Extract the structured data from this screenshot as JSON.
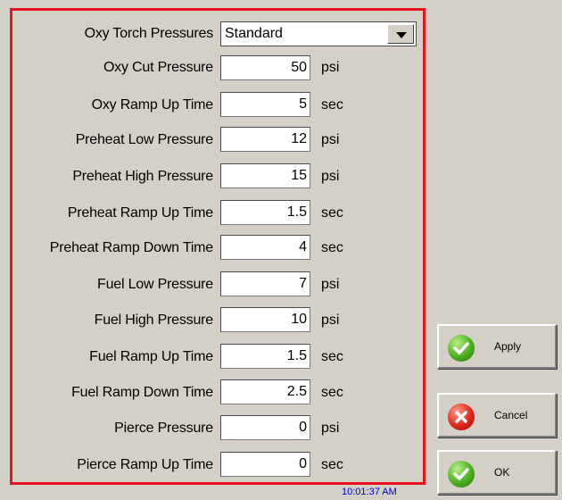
{
  "torch": {
    "label": "Oxy Torch Pressures",
    "value": "Standard"
  },
  "fields": [
    {
      "label": "Oxy Cut Pressure",
      "value": "50",
      "unit": "psi"
    },
    {
      "label": "Oxy Ramp Up Time",
      "value": "5",
      "unit": "sec"
    },
    {
      "label": "Preheat Low Pressure",
      "value": "12",
      "unit": "psi"
    },
    {
      "label": "Preheat High Pressure",
      "value": "15",
      "unit": "psi"
    },
    {
      "label": "Preheat Ramp Up Time",
      "value": "1.5",
      "unit": "sec"
    },
    {
      "label": "Preheat Ramp Down Time",
      "value": "4",
      "unit": "sec"
    },
    {
      "label": "Fuel Low Pressure",
      "value": "7",
      "unit": "psi"
    },
    {
      "label": "Fuel High Pressure",
      "value": "10",
      "unit": "psi"
    },
    {
      "label": "Fuel Ramp Up Time",
      "value": "1.5",
      "unit": "sec"
    },
    {
      "label": "Fuel Ramp Down Time",
      "value": "2.5",
      "unit": "sec"
    },
    {
      "label": "Pierce Pressure",
      "value": "0",
      "unit": "psi"
    },
    {
      "label": "Pierce Ramp Up Time",
      "value": "0",
      "unit": "sec"
    }
  ],
  "buttons": {
    "apply": "Apply",
    "cancel": "Cancel",
    "ok": "OK"
  },
  "clock": "10:01:37 AM",
  "colors": {
    "highlight_border": "#e8141c",
    "ok_icon": "#4cae1e",
    "cancel_icon": "#e0281c",
    "clock_text": "#0000cc"
  },
  "icons": {
    "apply": "check-icon",
    "cancel": "x-icon",
    "ok": "check-icon",
    "dropdown": "triangle-down-icon"
  }
}
